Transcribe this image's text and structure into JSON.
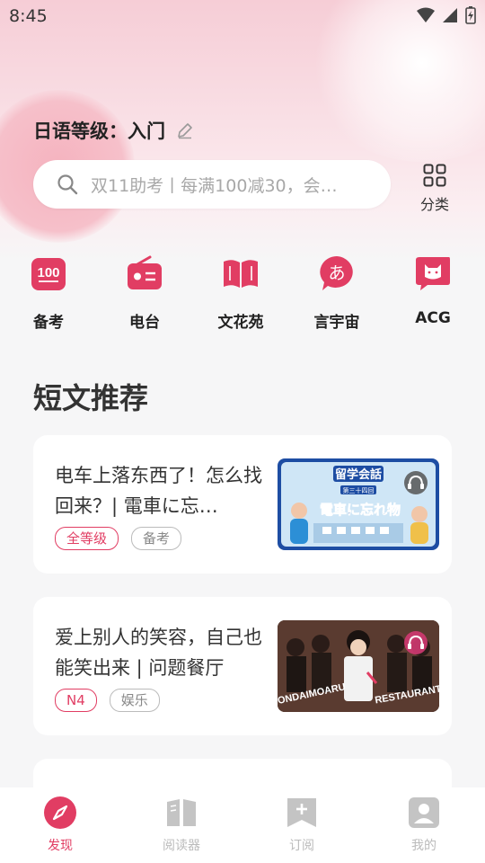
{
  "status_bar": {
    "time": "8:45"
  },
  "header": {
    "level_text": "日语等级：入门"
  },
  "search": {
    "placeholder": "双11助考丨每满100减30，会…"
  },
  "category_button": {
    "label": "分类"
  },
  "quick_nav": [
    {
      "label": "备考",
      "icon": "exam-100-icon",
      "badge": "100"
    },
    {
      "label": "电台",
      "icon": "radio-icon"
    },
    {
      "label": "文花苑",
      "icon": "book-icon"
    },
    {
      "label": "言宇宙",
      "icon": "hiragana-a-icon",
      "badge": "あ"
    },
    {
      "label": "ACG",
      "icon": "cat-face-icon"
    }
  ],
  "section": {
    "title": "短文推荐"
  },
  "articles": [
    {
      "title": "电车上落东西了！怎么找回来？| 電車に忘…",
      "tags": [
        "全等级",
        "备考"
      ],
      "thumb": {
        "line1": "留学会話",
        "line2": "第三十四回",
        "line3": "電車に忘れ物"
      }
    },
    {
      "title": "爱上别人的笑容，自己也能笑出来 | 问题餐厅",
      "tags": [
        "N4",
        "娱乐"
      ],
      "thumb": {
        "line1": "MONDAIMOARU",
        "line2": "RESTAURANT"
      }
    }
  ],
  "tabbar": [
    {
      "label": "发现",
      "icon": "compass-icon",
      "active": true
    },
    {
      "label": "阅读器",
      "icon": "open-book-icon",
      "active": false
    },
    {
      "label": "订阅",
      "icon": "bookmark-plus-icon",
      "active": false
    },
    {
      "label": "我的",
      "icon": "person-icon",
      "active": false
    }
  ],
  "colors": {
    "accent": "#e13d63",
    "background": "#f6f6f7",
    "hero_pink": "#f6cdd6"
  }
}
